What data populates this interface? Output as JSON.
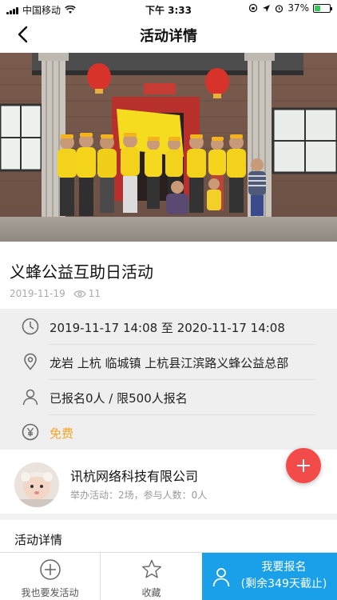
{
  "status_bar": {
    "carrier": "中国移动",
    "time": "下午 3:33",
    "battery": "37%",
    "battery_level": 0.37
  },
  "nav": {
    "title": "活动详情",
    "back_icon": "chevron-left-icon"
  },
  "activity": {
    "title": "义蜂公益互助日活动",
    "date": "2019-11-19",
    "views": "11"
  },
  "info": {
    "time_range": "2019-11-17 14:08 至 2020-11-17 14:08",
    "location": "龙岩 上杭 临城镇 上杭县江滨路义蜂公益总部",
    "signup": "已报名0人 / 限500人报名",
    "fee": "免费"
  },
  "organizer": {
    "name": "讯杭网络科技有限公司",
    "stats": "举办活动：2场，参与人数：0人"
  },
  "section": {
    "details_title": "活动详情"
  },
  "tabbar": {
    "publish_label": "我也要发活动",
    "favorite_label": "收藏",
    "signup_line1": "我要报名",
    "signup_line2": "(剩余349天截止)"
  },
  "colors": {
    "accent_blue": "#1aa0e8",
    "fee_orange": "#f5a623",
    "fab_red": "#f34a4a"
  }
}
